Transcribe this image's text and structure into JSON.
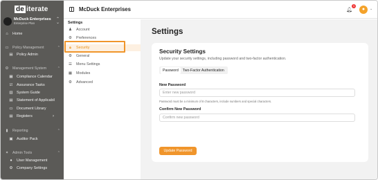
{
  "brand": {
    "logo_prefix": "de",
    "logo_suffix": "iterate",
    "accent": "#f0952b"
  },
  "org": {
    "name": "McDuck Enterprises",
    "plan": "Enterprise Plan"
  },
  "sidebar": {
    "home": "Home",
    "policy_section": "Policy Management",
    "policy_admin": "Policy Admin",
    "management_section": "Management System",
    "items": [
      "Compliance Calendar",
      "Assurance Tasks",
      "System Guide",
      "Statement of Applicabil",
      "Document Library",
      "Registers"
    ],
    "reporting_section": "Reporting",
    "auditor_pack": "Auditor Pack",
    "admin_section": "Admin Tools",
    "user_management": "User Management",
    "company_settings": "Company Settings"
  },
  "topbar": {
    "title": "McDuck Enterprises",
    "notification_count": "1"
  },
  "subnav": {
    "title": "Settings",
    "items": [
      "Account",
      "Preferences",
      "Security",
      "General",
      "Menu Settings",
      "Modules",
      "Advanced"
    ],
    "active": "Security"
  },
  "main": {
    "title": "Settings",
    "card": {
      "title": "Security Settings",
      "description": "Update your security settings, including password and two-factor authentication.",
      "tabs": [
        "Password",
        "Two-Factor Authentication"
      ],
      "new_password_label": "New Password",
      "new_password_placeholder": "Enter new password",
      "hint": "Password must be a minimum of 8 characters, include numbers and special characters.",
      "confirm_label": "Confirm New Password",
      "confirm_placeholder": "Confirm new password",
      "button": "Update Password"
    }
  }
}
